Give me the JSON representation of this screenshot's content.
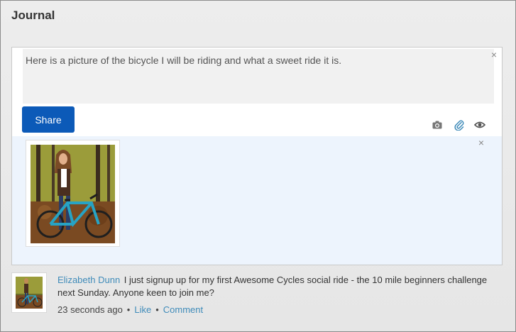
{
  "section": {
    "title": "Journal"
  },
  "composer": {
    "text": "Here is a picture of the bicycle I will be riding and what a sweet ride it is.",
    "close_icon": "×",
    "share_label": "Share",
    "tools": [
      "camera-icon",
      "attach-icon",
      "visibility-icon"
    ]
  },
  "attachment": {
    "close_icon": "×",
    "image": "photo of a woman standing with a bicycle in autumn woods"
  },
  "post": {
    "author": "Elizabeth Dunn",
    "text": "I just signup up for my first Awesome Cycles social ride - the 10 mile beginners challenge next Sunday. Anyone keen to join me?",
    "time": "23 seconds ago",
    "separator": "•",
    "like_label": "Like",
    "comment_label": "Comment"
  },
  "colors": {
    "accent": "#0c5ab8",
    "link": "#3f8bb9",
    "attachment_bg": "#edf4fd"
  }
}
